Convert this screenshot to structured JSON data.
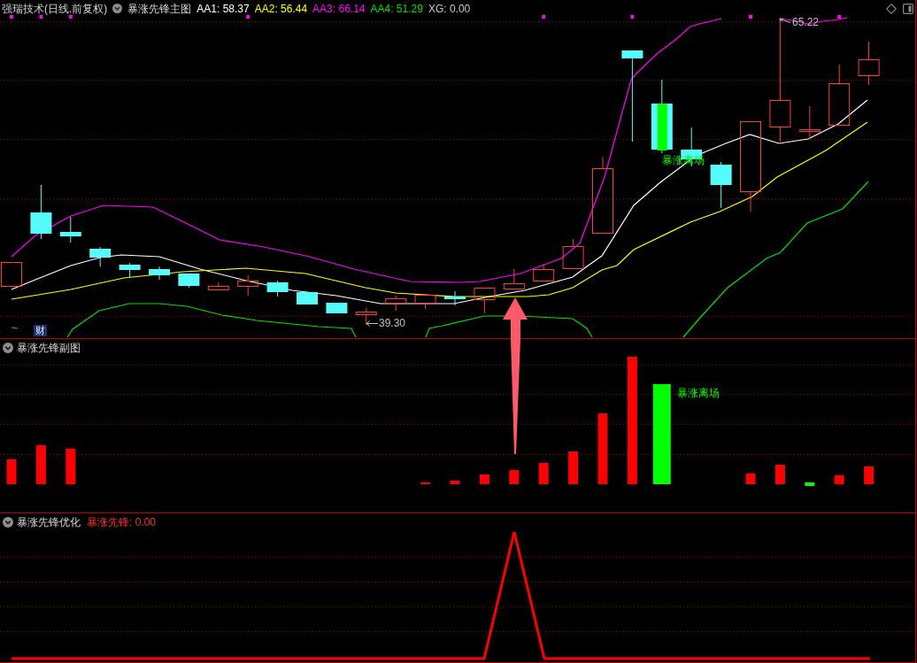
{
  "main_chart": {
    "title": "强瑞技术(日线.前复权)",
    "indicator": "暴涨先锋主图",
    "readouts": [
      {
        "text": "AA1: 58.37",
        "color": "#ffffff"
      },
      {
        "text": "AA2: 56.44",
        "color": "#ffff00"
      },
      {
        "text": "AA3: 66.14",
        "color": "#ff00ff"
      },
      {
        "text": "AA4: 51.29",
        "color": "#00e000"
      },
      {
        "text": "XG: 0.00",
        "color": "#c8c8c8"
      }
    ],
    "low_price": "39.30",
    "high_price": "65.22",
    "exit_signal": "暴涨离场",
    "badge": "财"
  },
  "sub_chart": {
    "indicator": "暴涨先锋副图",
    "exit_signal": "暴涨离场"
  },
  "signal_chart": {
    "indicator": "暴涨先锋优化",
    "reading": "暴涨先锋: 0.00"
  }
}
